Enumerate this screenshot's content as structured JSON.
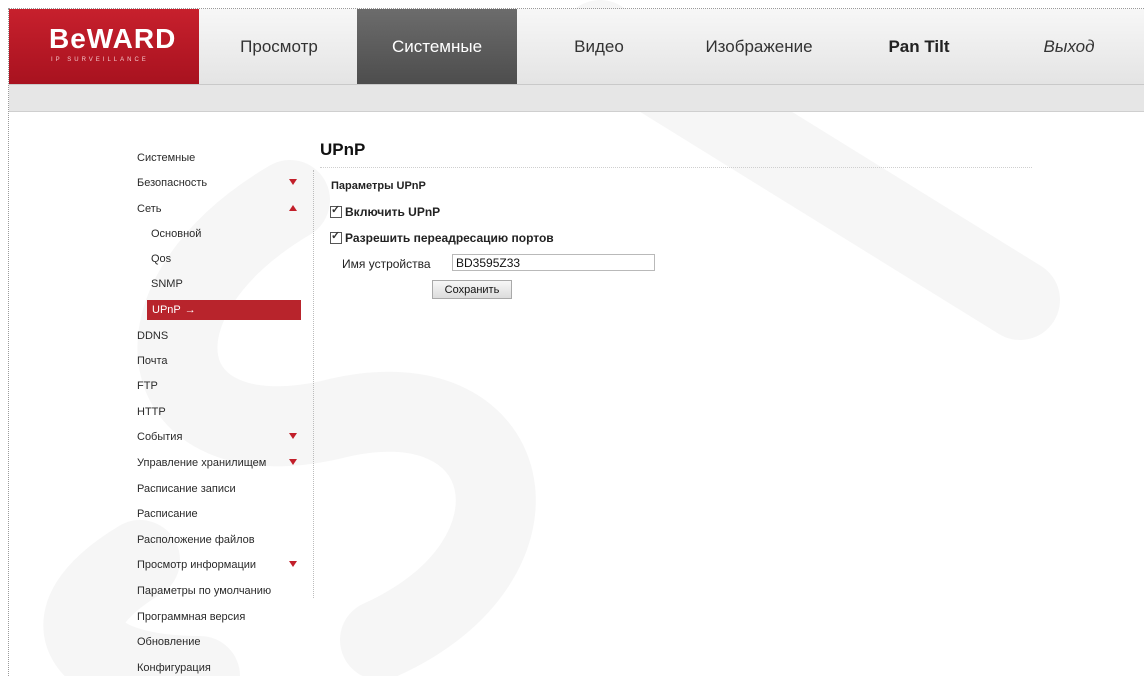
{
  "brand": {
    "logo_text": "BeWARD",
    "logo_sub": "IP SURVEILLANCE"
  },
  "nav": {
    "items": [
      "Просмотр",
      "Системные",
      "Видео",
      "Изображение",
      "Pan Tilt",
      "Выход"
    ],
    "active": "Системные"
  },
  "sidebar": {
    "items": [
      {
        "label": "Системные"
      },
      {
        "label": "Безопасность",
        "indicator": "down"
      },
      {
        "label": "Сеть",
        "indicator": "up"
      },
      {
        "label": "Основной",
        "sub": true
      },
      {
        "label": "Qos",
        "sub": true
      },
      {
        "label": "SNMP",
        "sub": true
      },
      {
        "label": "UPnP",
        "sub": true,
        "active": true,
        "arrow": "→"
      },
      {
        "label": "DDNS"
      },
      {
        "label": "Почта"
      },
      {
        "label": "FTP"
      },
      {
        "label": "HTTP"
      },
      {
        "label": "События",
        "indicator": "down"
      },
      {
        "label": "Управление хранилищем",
        "indicator": "down"
      },
      {
        "label": "Расписание записи"
      },
      {
        "label": "Расписание"
      },
      {
        "label": "Расположение файлов"
      },
      {
        "label": "Просмотр информации",
        "indicator": "down"
      },
      {
        "label": "Параметры по умолчанию"
      },
      {
        "label": "Программная версия"
      },
      {
        "label": "Обновление"
      },
      {
        "label": "Конфигурация"
      }
    ]
  },
  "main": {
    "title": "UPnP",
    "section_title": "Параметры UPnP",
    "enable_upnp": {
      "label": "Включить UPnP",
      "checked": true
    },
    "port_forwarding": {
      "label": "Разрешить переадресацию портов",
      "checked": true
    },
    "device_name": {
      "label": "Имя устройства",
      "value": "BD3595Z33"
    },
    "save_label": "Сохранить"
  },
  "colors": {
    "brand_red": "#c01f2b",
    "active_nav": "#555555",
    "watermark": "#ededed"
  }
}
